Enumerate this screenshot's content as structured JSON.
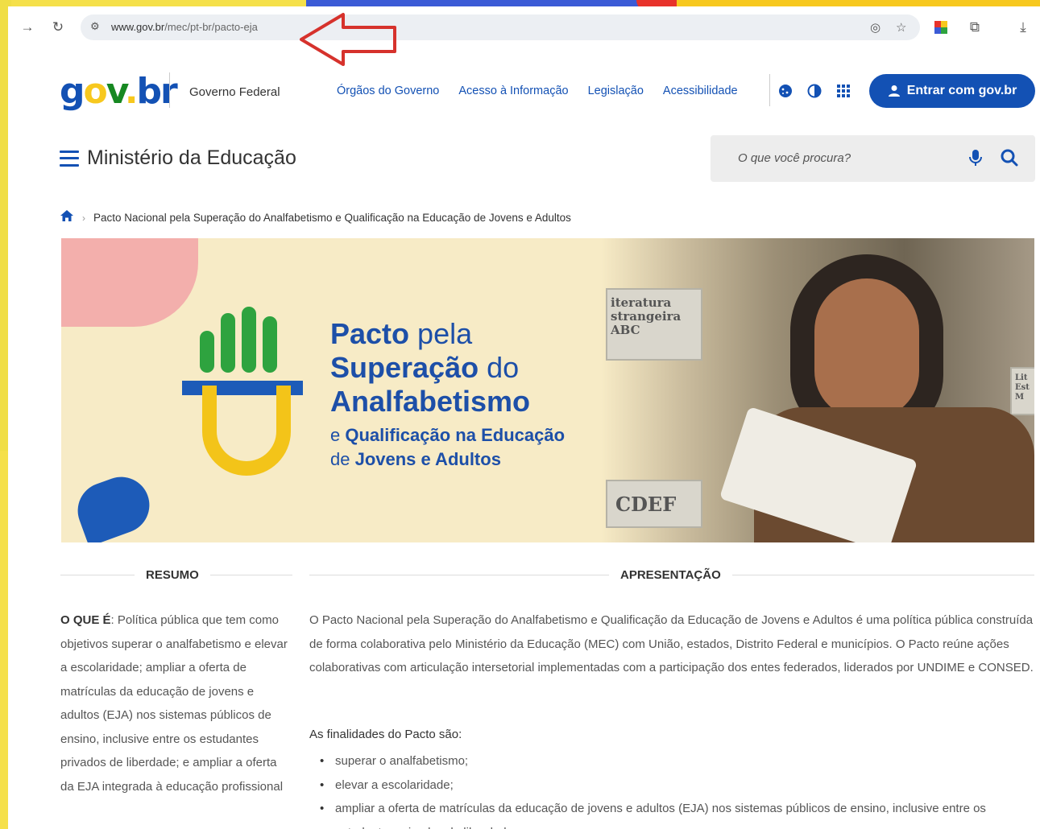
{
  "browser": {
    "url_domain": "www.gov.br",
    "url_path": "/mec/pt-br/pacto-eja"
  },
  "header": {
    "logo_parts": [
      "g",
      "o",
      "v",
      ".",
      "b",
      "r"
    ],
    "gov_label": "Governo Federal",
    "links": [
      "Órgãos do Governo",
      "Acesso à Informação",
      "Legislação",
      "Acessibilidade"
    ],
    "login_label": "Entrar com gov.br"
  },
  "ministry": {
    "title": "Ministério da Educação",
    "search_placeholder": "O que você procura?"
  },
  "breadcrumb": {
    "current": "Pacto Nacional pela Superação do Analfabetismo e Qualificação na Educação de Jovens e Adultos"
  },
  "banner": {
    "line1_bold": "Pacto",
    "line1_light": " pela",
    "line2_bold": "Superação",
    "line2_light": " do",
    "line3_bold": "Analfabetismo",
    "sub1_light": "e ",
    "sub1_bold": "Qualificação na Educação",
    "sub2_light": "de ",
    "sub2_bold": "Jovens e Adultos",
    "shelf_labels": [
      "iteratura\nstrangeira\nABC",
      "CDEF",
      "Lit\nEst\nM"
    ]
  },
  "resumo": {
    "heading": "RESUMO",
    "label": "O QUE É",
    "text": ": Política pública que tem como objetivos superar o analfabetismo e elevar a escolaridade; ampliar a oferta de matrículas da educação de jovens e adultos (EJA) nos sistemas públicos de ensino, inclusive entre os estudantes privados de liberdade; e ampliar a oferta da EJA integrada à educação profissional"
  },
  "apresentacao": {
    "heading": "APRESENTAÇÃO",
    "paragraph": "O Pacto Nacional pela Superação do Analfabetismo e Qualificação da Educação de Jovens e Adultos é uma política pública construída de forma colaborativa pelo Ministério da Educação (MEC) com União, estados, Distrito Federal e municípios. O Pacto reúne ações colaborativas com articulação intersetorial implementadas com a participação dos entes federados, liderados por UNDIME e CONSED.",
    "finalidades_label": "As finalidades do Pacto são:",
    "finalidades": [
      "superar o analfabetismo;",
      "elevar a escolaridade;",
      "ampliar a oferta de matrículas da educação de jovens e adultos (EJA) nos sistemas públicos de ensino, inclusive entre os estudantes privados de liberdade; e"
    ]
  },
  "colors": {
    "gov_blue": "#1351b4",
    "gov_green": "#168821",
    "gov_yellow": "#f7c81e",
    "annotation_red": "#d6322c"
  }
}
